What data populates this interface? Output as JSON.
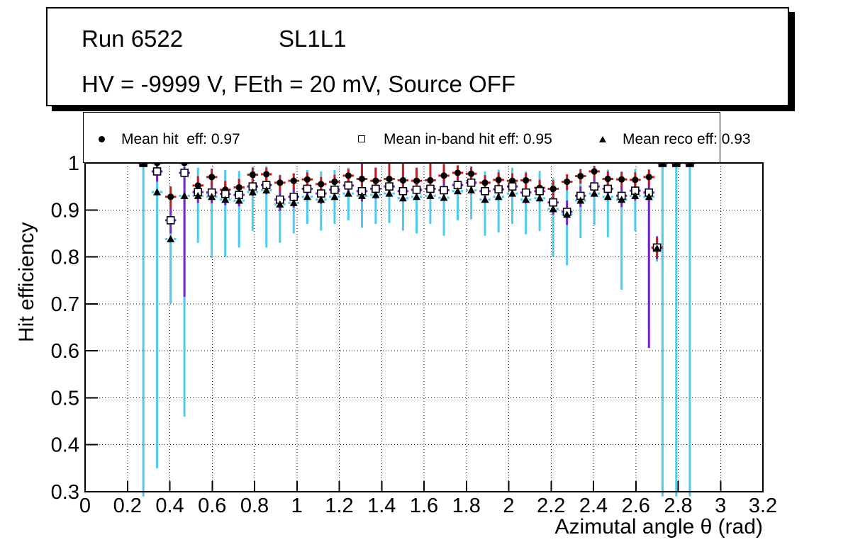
{
  "title_box": {
    "line1_left": "Run 6522",
    "line1_right": "SL1L1",
    "line2": "HV = -9999 V, FEth = 20 mV, Source OFF"
  },
  "legend": {
    "entries": [
      {
        "marker": "filled-circle-icon",
        "label": "Mean hit  eff: 0.97"
      },
      {
        "marker": "open-square-icon",
        "label": "Mean in-band hit eff: 0.95"
      },
      {
        "marker": "filled-triangle-icon",
        "label": "Mean reco eff: 0.93"
      }
    ]
  },
  "colors": {
    "hit_error": "#c41e1e",
    "inband_error": "#7c22cc",
    "reco_error": "#4ec9ef",
    "marker": "#000000",
    "grid": "#000000"
  },
  "chart_data": {
    "type": "scatter",
    "title": "",
    "xlabel": "Azimutal angle θ (rad)",
    "ylabel": "Hit efficiency",
    "xlim": [
      0,
      3.2
    ],
    "ylim": [
      0.3,
      1.0
    ],
    "xticks": [
      "0",
      "0.2",
      "0.4",
      "0.6",
      "0.8",
      "1",
      "1.2",
      "1.4",
      "1.6",
      "1.8",
      "2",
      "2.2",
      "2.4",
      "2.6",
      "2.8",
      "3",
      "3.2"
    ],
    "yticks": [
      "0.3",
      "0.4",
      "0.5",
      "0.6",
      "0.7",
      "0.8",
      "0.9",
      "1"
    ],
    "grid": "dotted",
    "legend_position": "top",
    "x_err": 0.026,
    "series": [
      {
        "name": "Mean hit  eff: 0.97",
        "mean": 0.97,
        "marker": "filled-circle",
        "error_color": "#c41e1e",
        "points": [
          [
            0.275,
            1.0,
            0.995,
            1.0
          ],
          [
            0.34,
            1.0,
            0.995,
            1.0
          ],
          [
            0.404,
            0.928,
            0.905,
            0.95
          ],
          [
            0.469,
            1.0,
            0.995,
            1.0
          ],
          [
            0.533,
            0.952,
            0.93,
            0.972
          ],
          [
            0.598,
            0.97,
            0.95,
            0.988
          ],
          [
            0.662,
            0.943,
            0.922,
            0.962
          ],
          [
            0.727,
            0.948,
            0.928,
            0.966
          ],
          [
            0.791,
            0.975,
            0.958,
            0.99
          ],
          [
            0.856,
            0.976,
            0.96,
            0.99
          ],
          [
            0.92,
            0.958,
            0.94,
            0.974
          ],
          [
            0.985,
            0.962,
            0.944,
            0.978
          ],
          [
            1.049,
            0.965,
            0.948,
            0.98
          ],
          [
            1.114,
            0.955,
            0.938,
            0.97
          ],
          [
            1.178,
            0.96,
            0.943,
            0.975
          ],
          [
            1.243,
            0.973,
            0.957,
            0.987
          ],
          [
            1.307,
            0.966,
            0.95,
            0.995
          ],
          [
            1.372,
            0.962,
            0.946,
            0.99
          ],
          [
            1.436,
            0.966,
            0.95,
            1.0
          ],
          [
            1.501,
            0.963,
            0.947,
            1.0
          ],
          [
            1.565,
            0.962,
            0.946,
            0.99
          ],
          [
            1.63,
            0.963,
            0.947,
            1.0
          ],
          [
            1.694,
            0.973,
            0.958,
            0.998
          ],
          [
            1.759,
            0.979,
            0.964,
            0.995
          ],
          [
            1.823,
            0.977,
            0.962,
            0.992
          ],
          [
            1.888,
            0.958,
            0.94,
            0.974
          ],
          [
            1.952,
            0.964,
            0.947,
            0.98
          ],
          [
            2.017,
            0.962,
            0.945,
            0.978
          ],
          [
            2.081,
            0.963,
            0.946,
            0.979
          ],
          [
            2.146,
            0.947,
            0.928,
            0.964
          ],
          [
            2.21,
            0.945,
            0.926,
            0.963
          ],
          [
            2.275,
            0.96,
            0.942,
            0.976
          ],
          [
            2.339,
            0.972,
            0.956,
            0.987
          ],
          [
            2.404,
            0.982,
            0.968,
            0.994
          ],
          [
            2.468,
            0.966,
            0.949,
            0.982
          ],
          [
            2.533,
            0.965,
            0.948,
            0.981
          ],
          [
            2.597,
            0.964,
            0.947,
            0.98
          ],
          [
            2.662,
            0.97,
            0.952,
            0.986
          ],
          [
            2.7,
            0.82,
            0.8,
            0.84
          ],
          [
            2.726,
            1.0,
            0.995,
            1.0
          ],
          [
            2.791,
            1.0,
            0.995,
            1.0
          ],
          [
            2.855,
            1.0,
            0.995,
            1.0
          ]
        ]
      },
      {
        "name": "Mean in-band hit eff: 0.95",
        "mean": 0.95,
        "marker": "open-square",
        "error_color": "#7c22cc",
        "points": [
          [
            0.275,
            1.0,
            0.99,
            1.0
          ],
          [
            0.34,
            0.982,
            0.96,
            0.995
          ],
          [
            0.404,
            0.878,
            0.85,
            0.905
          ],
          [
            0.469,
            0.979,
            0.715,
            0.992
          ],
          [
            0.533,
            0.938,
            0.915,
            0.958
          ],
          [
            0.598,
            0.937,
            0.914,
            0.957
          ],
          [
            0.662,
            0.934,
            0.91,
            0.955
          ],
          [
            0.727,
            0.932,
            0.908,
            0.953
          ],
          [
            0.791,
            0.95,
            0.93,
            0.968
          ],
          [
            0.856,
            0.953,
            0.933,
            0.97
          ],
          [
            0.92,
            0.922,
            0.898,
            0.943
          ],
          [
            0.985,
            0.928,
            0.905,
            0.948
          ],
          [
            1.049,
            0.945,
            0.924,
            0.963
          ],
          [
            1.114,
            0.935,
            0.913,
            0.954
          ],
          [
            1.178,
            0.943,
            0.922,
            0.962
          ],
          [
            1.243,
            0.952,
            0.932,
            0.97
          ],
          [
            1.307,
            0.94,
            0.918,
            1.0
          ],
          [
            1.372,
            0.945,
            0.924,
            0.99
          ],
          [
            1.436,
            0.95,
            0.93,
            0.995
          ],
          [
            1.501,
            0.94,
            0.918,
            0.99
          ],
          [
            1.565,
            0.943,
            0.922,
            0.962
          ],
          [
            1.63,
            0.945,
            0.924,
            1.0
          ],
          [
            1.694,
            0.942,
            0.92,
            0.988
          ],
          [
            1.759,
            0.953,
            0.934,
            0.97
          ],
          [
            1.823,
            0.958,
            0.94,
            0.974
          ],
          [
            1.888,
            0.94,
            0.918,
            0.96
          ],
          [
            1.952,
            0.944,
            0.923,
            0.963
          ],
          [
            2.017,
            0.95,
            0.93,
            0.968
          ],
          [
            2.081,
            0.937,
            0.914,
            0.957
          ],
          [
            2.146,
            0.94,
            0.918,
            0.96
          ],
          [
            2.21,
            0.916,
            0.89,
            0.938
          ],
          [
            2.275,
            0.896,
            0.868,
            0.92
          ],
          [
            2.339,
            0.93,
            0.906,
            0.95
          ],
          [
            2.404,
            0.95,
            0.93,
            0.968
          ],
          [
            2.468,
            0.945,
            0.924,
            0.963
          ],
          [
            2.533,
            0.93,
            0.906,
            0.95
          ],
          [
            2.597,
            0.941,
            0.92,
            0.96
          ],
          [
            2.662,
            0.937,
            0.606,
            0.957
          ],
          [
            2.7,
            0.82,
            0.795,
            0.843
          ],
          [
            2.726,
            1.0,
            0.99,
            1.0
          ],
          [
            2.791,
            1.0,
            0.99,
            1.0
          ],
          [
            2.855,
            1.0,
            0.99,
            1.0
          ]
        ]
      },
      {
        "name": "Mean reco eff: 0.93",
        "mean": 0.93,
        "marker": "filled-triangle",
        "error_color": "#4ec9ef",
        "points": [
          [
            0.275,
            1.0,
            0.29,
            1.0
          ],
          [
            0.34,
            0.938,
            0.35,
            0.995
          ],
          [
            0.404,
            0.838,
            0.7,
            0.9
          ],
          [
            0.469,
            0.93,
            0.46,
            0.99
          ],
          [
            0.533,
            0.93,
            0.83,
            0.99
          ],
          [
            0.598,
            0.928,
            0.798,
            0.988
          ],
          [
            0.662,
            0.922,
            0.8,
            0.985
          ],
          [
            0.727,
            0.92,
            0.82,
            0.983
          ],
          [
            0.791,
            0.938,
            0.855,
            0.992
          ],
          [
            0.856,
            0.942,
            0.82,
            0.993
          ],
          [
            0.92,
            0.912,
            0.83,
            0.975
          ],
          [
            0.985,
            0.915,
            0.85,
            0.977
          ],
          [
            1.049,
            0.928,
            0.87,
            0.985
          ],
          [
            1.114,
            0.922,
            0.856,
            0.982
          ],
          [
            1.178,
            0.928,
            0.87,
            0.985
          ],
          [
            1.243,
            0.935,
            0.878,
            0.99
          ],
          [
            1.307,
            0.93,
            0.862,
            0.988
          ],
          [
            1.372,
            0.932,
            0.87,
            0.988
          ],
          [
            1.436,
            0.935,
            0.872,
            0.99
          ],
          [
            1.501,
            0.925,
            0.856,
            0.984
          ],
          [
            1.565,
            0.928,
            0.85,
            0.986
          ],
          [
            1.63,
            0.93,
            0.87,
            0.987
          ],
          [
            1.694,
            0.926,
            0.845,
            0.985
          ],
          [
            1.759,
            0.94,
            0.878,
            0.992
          ],
          [
            1.823,
            0.942,
            0.88,
            0.993
          ],
          [
            1.888,
            0.922,
            0.845,
            0.982
          ],
          [
            1.952,
            0.928,
            0.852,
            0.986
          ],
          [
            2.017,
            0.935,
            0.87,
            0.99
          ],
          [
            2.081,
            0.922,
            0.848,
            0.982
          ],
          [
            2.146,
            0.925,
            0.855,
            0.983
          ],
          [
            2.21,
            0.902,
            0.8,
            0.968
          ],
          [
            2.275,
            0.89,
            0.782,
            0.96
          ],
          [
            2.339,
            0.92,
            0.84,
            0.98
          ],
          [
            2.404,
            0.935,
            0.868,
            0.99
          ],
          [
            2.468,
            0.928,
            0.842,
            0.986
          ],
          [
            2.533,
            0.922,
            0.73,
            0.982
          ],
          [
            2.597,
            0.93,
            0.855,
            0.987
          ],
          [
            2.662,
            0.928,
            0.65,
            0.986
          ],
          [
            2.7,
            0.818,
            0.79,
            0.845
          ],
          [
            2.726,
            1.0,
            0.29,
            1.0
          ],
          [
            2.791,
            1.0,
            0.29,
            1.0
          ],
          [
            2.855,
            1.0,
            0.29,
            1.0
          ]
        ]
      }
    ]
  }
}
